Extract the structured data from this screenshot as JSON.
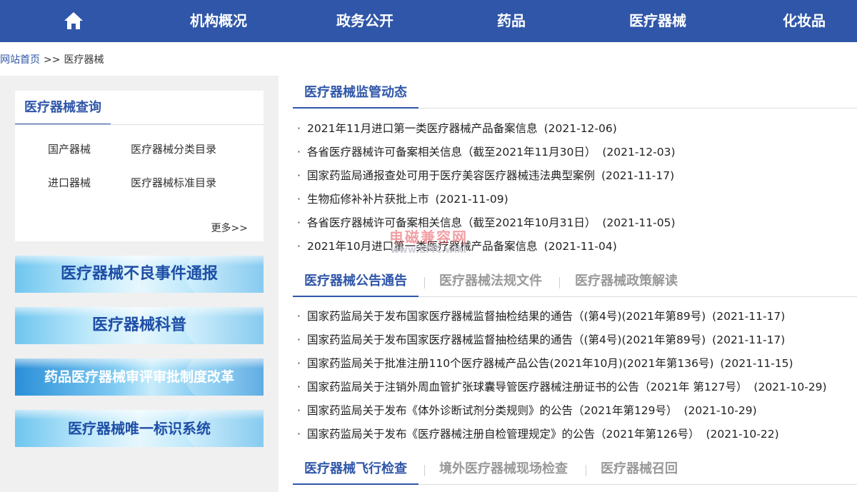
{
  "nav": {
    "home_icon": "home-icon",
    "items": [
      "机构概况",
      "政务公开",
      "药品",
      "医疗器械",
      "化妆品"
    ]
  },
  "breadcrumb": {
    "home": "网站首页",
    "separator": ">>",
    "current": "医疗器械"
  },
  "query": {
    "title": "医疗器械查询",
    "links": [
      "国产器械",
      "医疗器械分类目录",
      "进口器械",
      "医疗器械标准目录"
    ],
    "more": "更多>>"
  },
  "banners": [
    "医疗器械不良事件通报",
    "医疗器械科普",
    "药品医疗器械审评审批制度改革",
    "医疗器械唯一标识系统"
  ],
  "sections": [
    {
      "tabs": [
        "医疗器械监管动态"
      ],
      "items": [
        {
          "title": "2021年11月进口第一类医疗器械产品备案信息",
          "date": "(2021-12-06)"
        },
        {
          "title": "各省医疗器械许可备案相关信息（截至2021年11月30日）",
          "date": "(2021-12-03)"
        },
        {
          "title": "国家药监局通报查处可用于医疗美容医疗器械违法典型案例",
          "date": "(2021-11-17)"
        },
        {
          "title": "生物疝修补补片获批上市",
          "date": "(2021-11-09)"
        },
        {
          "title": "各省医疗器械许可备案相关信息（截至2021年10月31日）",
          "date": "(2021-11-05)"
        },
        {
          "title": "2021年10月进口第一类医疗器械产品备案信息",
          "date": "(2021-11-04)"
        }
      ]
    },
    {
      "tabs": [
        "医疗器械公告通告",
        "医疗器械法规文件",
        "医疗器械政策解读"
      ],
      "items": [
        {
          "title": "国家药监局关于发布国家医疗器械监督抽检结果的通告（(第4号)(2021年第89号)",
          "date": "(2021-11-17)"
        },
        {
          "title": "国家药监局关于发布国家医疗器械监督抽检结果的通告（(第4号)(2021年第89号)",
          "date": "(2021-11-17)"
        },
        {
          "title": "国家药监局关于批准注册110个医疗器械产品公告(2021年10月)(2021年第136号)",
          "date": "(2021-11-15)"
        },
        {
          "title": "国家药监局关于注销外周血管扩张球囊导管医疗器械注册证书的公告（2021年 第127号）",
          "date": "(2021-10-29)"
        },
        {
          "title": "国家药监局关于发布《体外诊断试剂分类规则》的公告（2021年第129号）",
          "date": "(2021-10-29)"
        },
        {
          "title": "国家药监局关于发布《医疗器械注册自检管理规定》的公告（2021年第126号）",
          "date": "(2021-10-22)"
        }
      ]
    },
    {
      "tabs": [
        "医疗器械飞行检查",
        "境外医疗器械现场检查",
        "医疗器械召回"
      ],
      "items": []
    }
  ],
  "watermark": {
    "cn": "电磁兼容网",
    "en": "www.EMC.wiki"
  },
  "colors": {
    "primary": "#2f56a8",
    "sidebar_bg": "#f0f0f0",
    "inactive_tab": "#999999"
  }
}
